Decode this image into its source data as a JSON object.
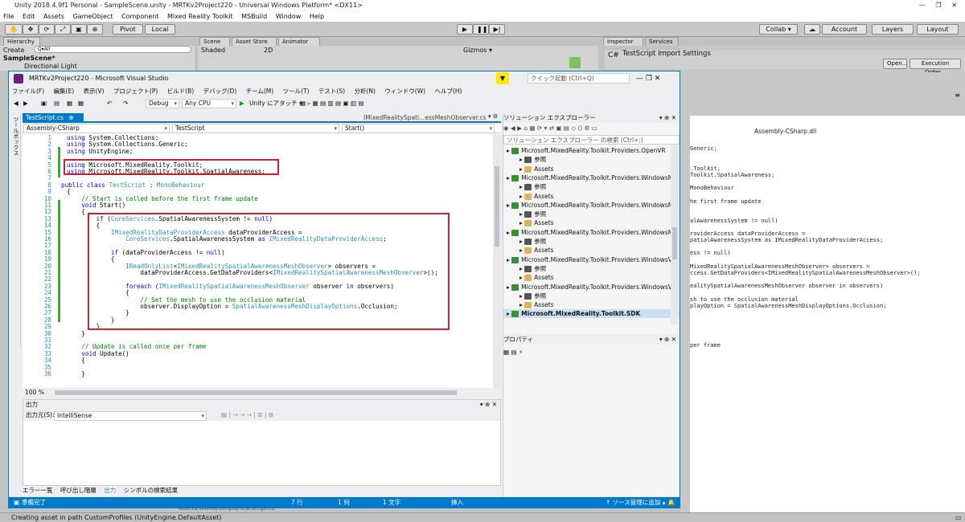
{
  "unity": {
    "title": "Unity 2018.4.9f1 Personal - SampleScene.unity - MRTKv2Project220 - Universal Windows Platform* <DX11>",
    "menu": [
      "File",
      "Edit",
      "Assets",
      "GameObject",
      "Component",
      "Mixed Reality Toolkit",
      "MSBuild",
      "Window",
      "Help"
    ],
    "pivot": "Pivot",
    "local": "Local",
    "collab": "Collab ▾",
    "account": "Account",
    "layers": "Layers",
    "layout": "Layout",
    "hierarchy_tab": "Hierarchy",
    "create": "Create",
    "search_all": "Q▾All",
    "scene_name": "SampleScene*",
    "directional_light": "Directional Light",
    "scene_tab": "Scene",
    "asset_store_tab": "Asset Store",
    "animator_tab": "Animator",
    "shaded": "Shaded",
    "mode2d": "2D",
    "gizmos": "Gizmos ▾",
    "inspector_tab": "Inspector",
    "services_tab": "Services",
    "import_settings": "TestScript Import Settings",
    "open_btn": "Open...",
    "exec_order_btn": "Execution Order...",
    "assembly_dll": "Assembly-CSharp.dll",
    "insp_lines": [
      "Generic;",
      ".Toolkit;",
      "Toolkit.SpatialAwareness;",
      "MonoBehaviour",
      "he first frame update",
      "alAwarenessSystem != null)",
      "roviderAccess dataProviderAccess =",
      "patialAwarenessSystem as IMixedRealityDataProviderAccess;",
      "ess != null)",
      "MixedRealitySpatialAwarenessMeshObserver> observers =",
      "ccess.GetDataProviders<IMixedRealitySpatialAwarenessMeshObserver>();",
      "ealitySpatialAwarenessMeshObserver observer in observers)",
      "sh to use the occlusion material",
      "playOption = SpatialAwarenessMeshDisplayOptions.Occlusion;",
      "per frame"
    ],
    "status": "Creating asset in path CustomProfiles (UnityEngine.DefaultAsset)",
    "bg_path": "Assets/WORK/Scripts/TestScript.cs"
  },
  "vs": {
    "title": "MRTKv2Project220 - Microsoft Visual Studio",
    "quick_launch": "クイック起動 (Ctrl+Q)",
    "menu": [
      "ファイル(F)",
      "編集(E)",
      "表示(V)",
      "プロジェクト(P)",
      "ビルド(B)",
      "デバッグ(D)",
      "チーム(M)",
      "ツール(T)",
      "テスト(S)",
      "分析(N)",
      "ウィンドウ(W)",
      "ヘルプ(H)"
    ],
    "config": "Debug",
    "platform": "Any CPU",
    "attach": "Unity にアタッチ ▾",
    "toolbox": "ツールボックス",
    "file_tab": "TestScript.cs",
    "file_tab2": "IMixedRealitySpati...essMeshObserver.cs",
    "nav_project": "Assembly-CSharp",
    "nav_class": "TestScript",
    "nav_member": "Start()",
    "zoom": "100 %",
    "line_numbers": [
      "1",
      "2",
      "3",
      "4",
      "5",
      "6",
      "7",
      "8",
      "9",
      "10",
      "11",
      "12",
      "13",
      "14",
      "15",
      "16",
      "17",
      "18",
      "19",
      "20",
      "21",
      "22",
      "23",
      "24",
      "25",
      "26",
      "27",
      "28",
      "29",
      "30",
      "31",
      "32",
      "33",
      "34",
      "35",
      "36"
    ],
    "output_title": "出力",
    "output_from": "出力元(S):",
    "output_source": "IntelliSense",
    "bottom_tabs": [
      "エラー一覧",
      "呼び出し階層",
      "出力",
      "シンボルの検索結果"
    ],
    "se_title": "ソリューション エクスプローラー",
    "se_search": "ソリューション エクスプローラー の検索 (Ctrl+;)",
    "se_items": [
      "Microsoft.MixedReality.Toolkit.Providers.OpenVR",
      "参照",
      "Assets",
      "Microsoft.MixedReality.Toolkit.Providers.WindowsMi",
      "参照",
      "Assets",
      "Microsoft.MixedReality.Toolkit.Providers.WindowsMi",
      "参照",
      "Assets",
      "Microsoft.MixedReality.Toolkit.Providers.WindowsMi",
      "参照",
      "Assets",
      "Microsoft.MixedReality.Toolkit.Providers.WindowsVoi",
      "参照",
      "Assets",
      "Microsoft.MixedReality.Toolkit.Providers.WindowsVoi",
      "参照",
      "Assets",
      "Microsoft.MixedReality.Toolkit.SDK"
    ],
    "props_title": "プロパティ",
    "status": {
      "ready": "準備完了",
      "line": "7 行",
      "col": "1 列",
      "char": "1 文字",
      "ins": "挿入",
      "vcs": "↑ ソース管理に追加 ▴"
    }
  },
  "colors": {
    "vs_accent": "#007acc",
    "keyword": "#0000ff",
    "type": "#2b91af",
    "comment": "#008000",
    "highlight": "#c8252e"
  }
}
